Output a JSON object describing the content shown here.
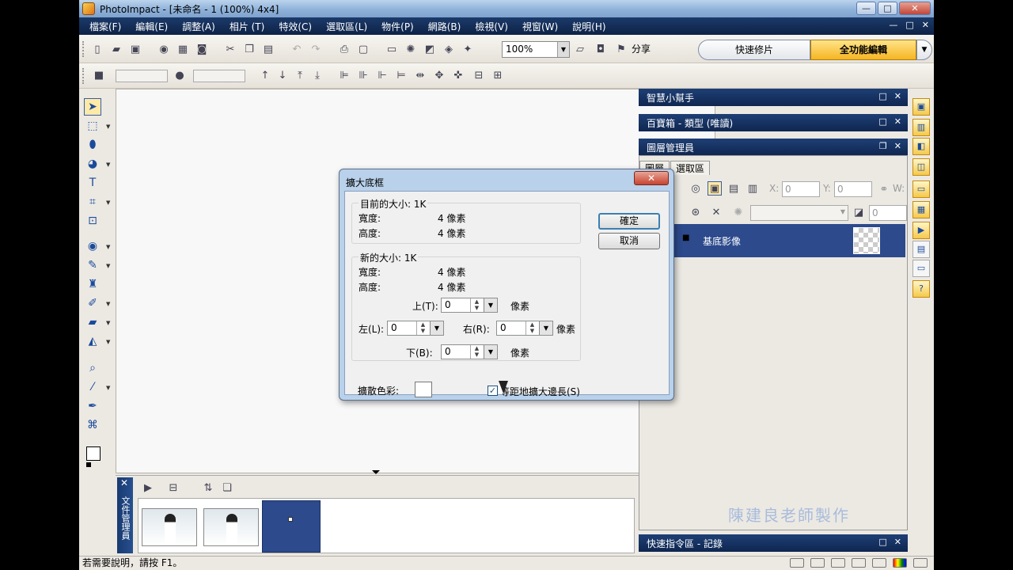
{
  "window": {
    "title": "PhotoImpact - [未命名 - 1 (100%) 4x4]",
    "minimize": "—",
    "maximize": "□",
    "close": "✕"
  },
  "menu": [
    "檔案(F)",
    "編輯(E)",
    "調整(A)",
    "相片 (T)",
    "特效(C)",
    "選取區(L)",
    "物件(P)",
    "網路(B)",
    "檢視(V)",
    "視窗(W)",
    "說明(H)"
  ],
  "mdi_controls": [
    "—",
    "□",
    "✕"
  ],
  "toolbar": {
    "zoom": "100%",
    "share": "分享"
  },
  "mode": {
    "quick": "快速修片",
    "full": "全功能編輯",
    "dropdown": "▼"
  },
  "tools": [
    "arrow",
    "select",
    "lasso",
    "paint",
    "text",
    "crop",
    "transform",
    "eye",
    "brush",
    "stamp",
    "retouch",
    "eraser",
    "fill",
    "zoom",
    "dropper",
    "pen",
    "path"
  ],
  "panels": {
    "smart_helper": "智慧小幫手",
    "easypalette": "百寶箱 - 類型 (唯讀)",
    "layer_manager": "圖層管理員",
    "quick_command": "快速指令區 - 記錄",
    "tabs": [
      "圖層",
      "選取區"
    ],
    "layer_fields": {
      "x_label": "X:",
      "x_value": "0",
      "y_label": "Y:",
      "y_value": "0",
      "w_label": "W:",
      "opacity": "0"
    },
    "layer_name": "基底影像",
    "watermark": "陳建良老師製作"
  },
  "docmgr": {
    "side_label": "文件管理員"
  },
  "status": {
    "text": "若需要說明，請按 F1。"
  },
  "dialog": {
    "title": "擴大底框",
    "close": "✕",
    "ok": "確定",
    "cancel": "取消",
    "current_size_label": "目前的大小: 1K",
    "current_width_label": "寬度:",
    "current_width_value": "4 像素",
    "current_height_label": "高度:",
    "current_height_value": "4 像素",
    "new_size_label": "新的大小: 1K",
    "new_width_label": "寬度:",
    "new_width_value": "4 像素",
    "new_height_label": "高度:",
    "new_height_value": "4 像素",
    "top_label": "上(T):",
    "top_value": "0",
    "left_label": "左(L):",
    "left_value": "0",
    "right_label": "右(R):",
    "right_value": "0",
    "bottom_label": "下(B):",
    "bottom_value": "0",
    "unit": "像素",
    "color_label": "擴散色彩:",
    "checkbox_label": "等距地擴大邊長(S)",
    "checkbox_checked": true
  }
}
